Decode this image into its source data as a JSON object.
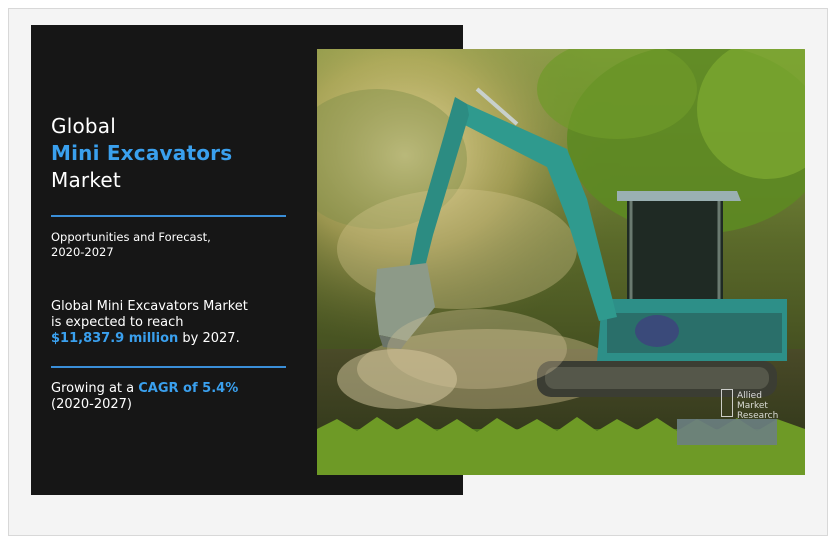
{
  "title": {
    "line1": "Global",
    "line2": "Mini Excavators",
    "line3": "Market"
  },
  "subtitle": {
    "line1": "Opportunities and Forecast,",
    "line2": "2020-2027"
  },
  "reach": {
    "line1": "Global Mini Excavators Market",
    "line2": "is expected to reach",
    "value": "$11,837.9 million",
    "suffix": " by 2027."
  },
  "cagr": {
    "prefix": "Growing at a ",
    "value": "CAGR of 5.4%",
    "period": "(2020-2027)"
  },
  "logo": {
    "line1": "Allied",
    "line2": "Market",
    "line3": "Research"
  },
  "colors": {
    "accent": "#3aa0ee",
    "panel": "#161616",
    "rule": "#3a8ed8"
  },
  "image": {
    "subject": "excavator-photo"
  }
}
